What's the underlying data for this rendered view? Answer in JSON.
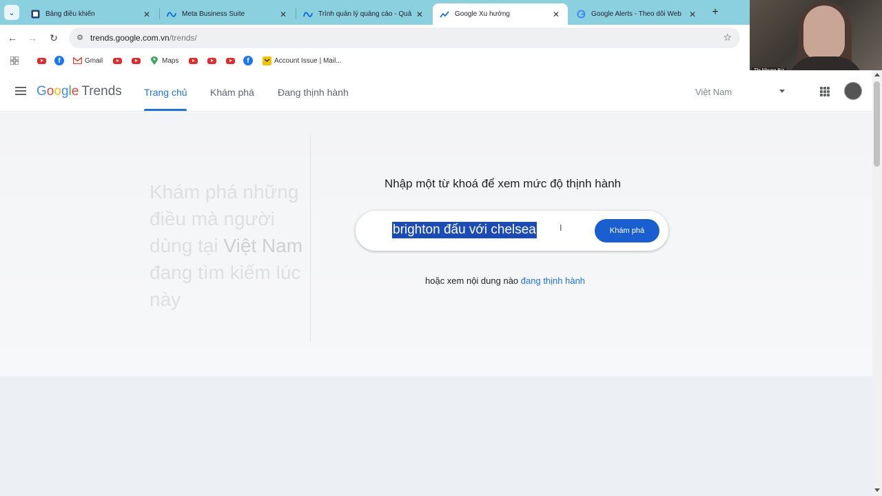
{
  "browser": {
    "tabs": [
      {
        "title": "Bảng điều khiển",
        "favicon": "dashboard-icon",
        "active": false
      },
      {
        "title": "Meta Business Suite",
        "favicon": "meta-icon",
        "active": false
      },
      {
        "title": "Trình quản lý quảng cáo - Quả",
        "favicon": "meta-icon",
        "active": false
      },
      {
        "title": "Google Xu hướng",
        "favicon": "trends-icon",
        "active": true
      },
      {
        "title": "Google Alerts - Theo dõi Web",
        "favicon": "google-icon",
        "active": false
      }
    ],
    "url_host": "trends.google.com.vn",
    "url_path": "/trends/",
    "bookmarks": [
      "Gmail",
      "Maps",
      "Account Issue | Mail..."
    ]
  },
  "video_overlay": {
    "name": "Thi Nhung Bùi"
  },
  "header": {
    "logo_google": [
      "G",
      "o",
      "o",
      "g",
      "l",
      "e"
    ],
    "logo_product": "Trends",
    "nav": [
      "Trang chủ",
      "Khám phá",
      "Đang thịnh hành"
    ],
    "country": "Việt Nam"
  },
  "hero": {
    "tagline_parts": [
      "Khám phá những điều mà người dùng tại",
      "Việt Nam",
      "đang tìm kiếm lúc này"
    ],
    "prompt": "Nhập một từ khoá để xem mức độ thịnh hành",
    "search_value": "brighton đấu với chelsea",
    "explore_button": "Khám phá",
    "or_text": "hoặc xem nội dung nào",
    "or_link": "đang thịnh hành"
  },
  "colors": {
    "accent": "#1a73e8",
    "tab_strip": "#8ad0df",
    "selection": "#1b4bb5"
  }
}
